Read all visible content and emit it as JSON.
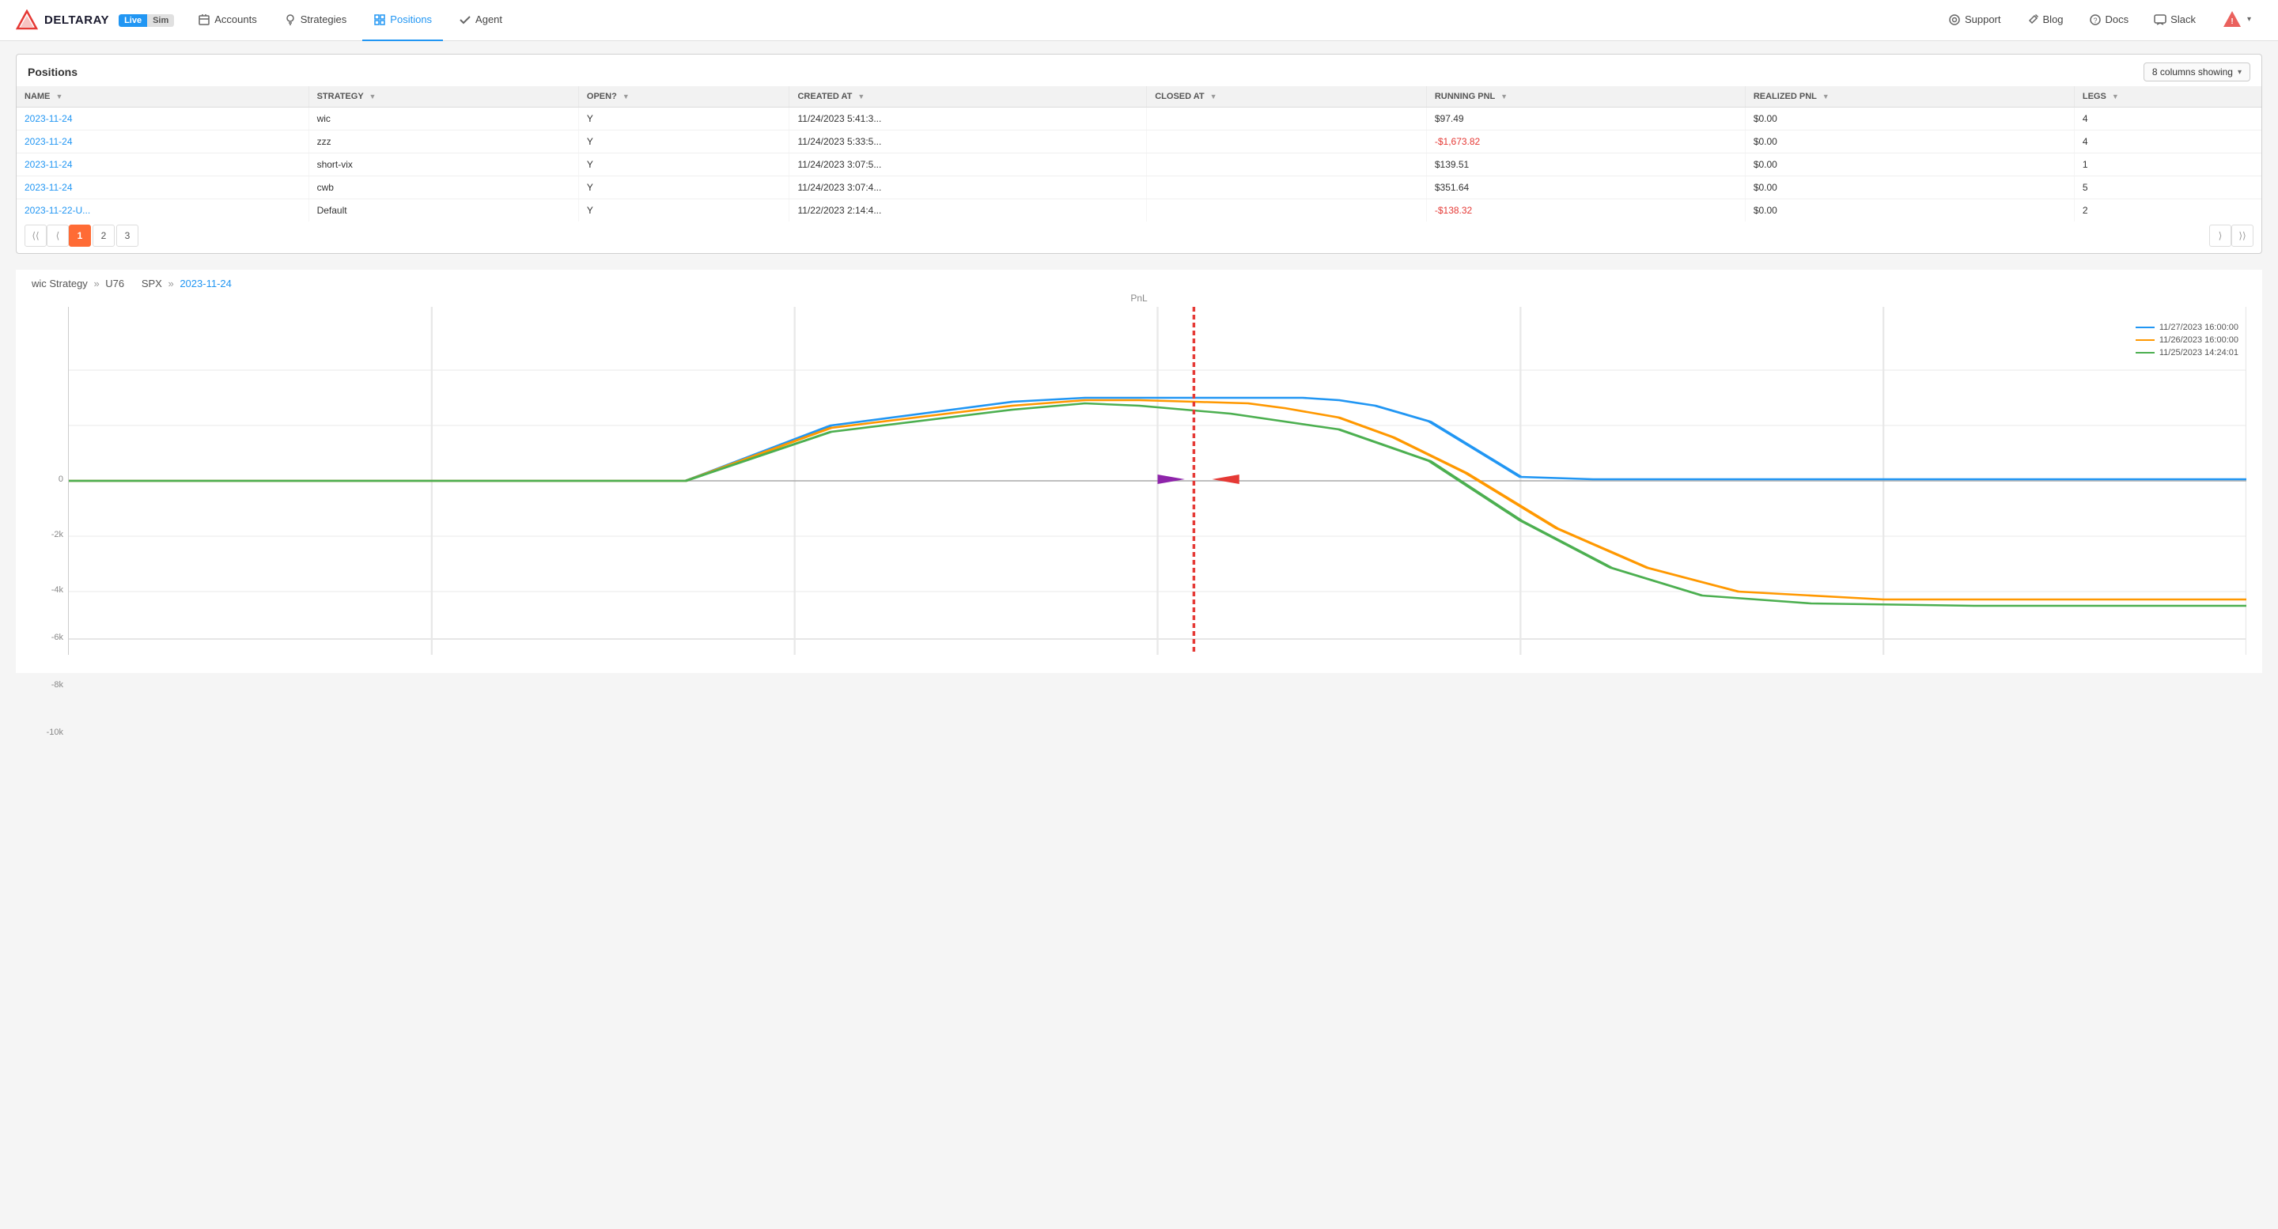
{
  "app": {
    "name": "DELTARAY",
    "badge_live": "Live",
    "badge_sim": "Sim"
  },
  "nav": {
    "items": [
      {
        "id": "accounts",
        "label": "Accounts",
        "icon": "building-icon",
        "active": false
      },
      {
        "id": "strategies",
        "label": "Strategies",
        "icon": "lightbulb-icon",
        "active": false
      },
      {
        "id": "positions",
        "label": "Positions",
        "icon": "grid-icon",
        "active": true
      },
      {
        "id": "agent",
        "label": "Agent",
        "icon": "check-icon",
        "active": false
      }
    ],
    "right_items": [
      {
        "id": "support",
        "label": "Support",
        "icon": "life-ring-icon"
      },
      {
        "id": "blog",
        "label": "Blog",
        "icon": "wrench-icon"
      },
      {
        "id": "docs",
        "label": "Docs",
        "icon": "question-icon"
      },
      {
        "id": "slack",
        "label": "Slack",
        "icon": "message-icon"
      }
    ]
  },
  "positions_table": {
    "title": "Positions",
    "columns_label": "8 columns showing",
    "columns": [
      {
        "id": "name",
        "label": "NAME"
      },
      {
        "id": "strategy",
        "label": "STRATEGY"
      },
      {
        "id": "open",
        "label": "OPEN?"
      },
      {
        "id": "created_at",
        "label": "CREATED AT"
      },
      {
        "id": "closed_at",
        "label": "CLOSED AT"
      },
      {
        "id": "running_pnl",
        "label": "RUNNING PNL"
      },
      {
        "id": "realized_pnl",
        "label": "REALIZED PNL"
      },
      {
        "id": "legs",
        "label": "LEGS"
      }
    ],
    "rows": [
      {
        "name": "2023-11-24",
        "strategy": "wic",
        "open": "Y",
        "created_at": "11/24/2023 5:41:3...",
        "closed_at": "",
        "running_pnl": "$97.49",
        "realized_pnl": "$0.00",
        "legs": "4"
      },
      {
        "name": "2023-11-24",
        "strategy": "zzz",
        "open": "Y",
        "created_at": "11/24/2023 5:33:5...",
        "closed_at": "",
        "running_pnl": "-$1,673.82",
        "realized_pnl": "$0.00",
        "legs": "4"
      },
      {
        "name": "2023-11-24",
        "strategy": "short-vix",
        "open": "Y",
        "created_at": "11/24/2023 3:07:5...",
        "closed_at": "",
        "running_pnl": "$139.51",
        "realized_pnl": "$0.00",
        "legs": "1"
      },
      {
        "name": "2023-11-24",
        "strategy": "cwb",
        "open": "Y",
        "created_at": "11/24/2023 3:07:4...",
        "closed_at": "",
        "running_pnl": "$351.64",
        "realized_pnl": "$0.00",
        "legs": "5"
      },
      {
        "name": "2023-11-22-U...",
        "strategy": "Default",
        "open": "Y",
        "created_at": "11/22/2023 2:14:4...",
        "closed_at": "",
        "running_pnl": "-$138.32",
        "realized_pnl": "$0.00",
        "legs": "2"
      }
    ],
    "pagination": {
      "pages": [
        "1",
        "2",
        "3"
      ],
      "active_page": "1"
    }
  },
  "chart": {
    "breadcrumb_strategy": "wic Strategy",
    "breadcrumb_arrow": "»",
    "breadcrumb_id": "U76",
    "breadcrumb_symbol": "SPX",
    "breadcrumb_date": "2023-11-24",
    "pnl_label": "PnL",
    "y_axis_labels": [
      "0",
      "-2k",
      "-4k",
      "-6k",
      "-8k",
      "-10k"
    ],
    "legend": [
      {
        "label": "11/27/2023 16:00:00",
        "color": "#2196f3"
      },
      {
        "label": "11/26/2023 16:00:00",
        "color": "#ff9800"
      },
      {
        "label": "11/25/2023 14:24:01",
        "color": "#4caf50"
      }
    ]
  }
}
